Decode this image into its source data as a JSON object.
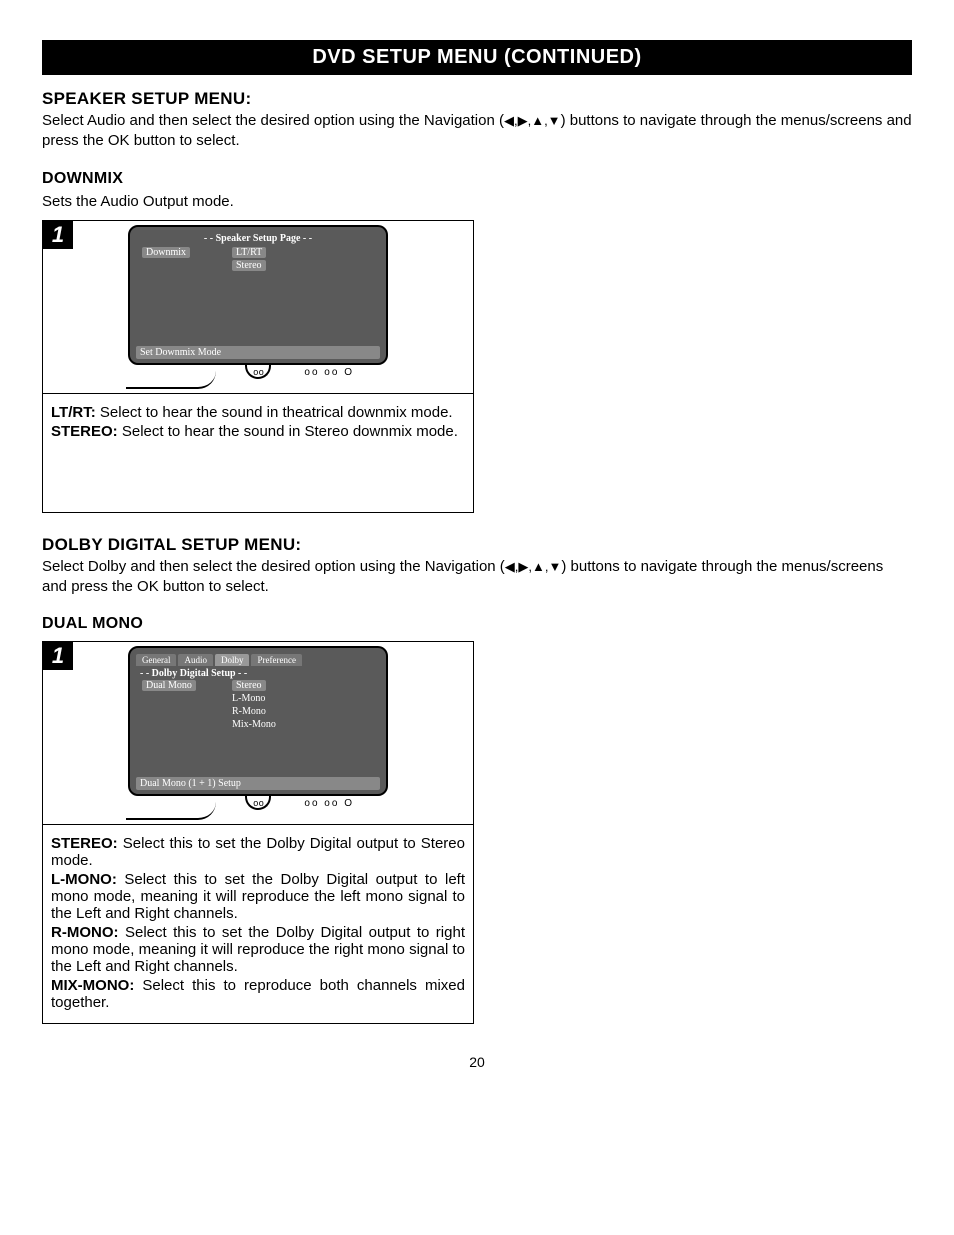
{
  "title_bar": "DVD SETUP MENU (CONTINUED)",
  "speaker": {
    "heading": "SPEAKER SETUP MENU:",
    "intro_a": "Select Audio and then select the desired option using the Navigation (",
    "intro_b": ") buttons to navigate through the menus/screens and press the OK button to select.",
    "arrows": "◀,▶,▲,▼"
  },
  "downmix": {
    "heading": "DOWNMIX",
    "intro": "Sets the Audio Output mode.",
    "step": "1",
    "screen": {
      "title": "- - Speaker Setup Page - -",
      "left": "Downmix",
      "opt1": "LT/RT",
      "opt2": "Stereo",
      "footer": "Set Downmix Mode"
    },
    "desc": {
      "ltrt_t": "LT/RT:",
      "ltrt": " Select to hear the sound in theatrical downmix mode.",
      "stereo_t": "STEREO:",
      "stereo": " Select to hear the sound in Stereo downmix mode."
    }
  },
  "dolby": {
    "heading": "DOLBY DIGITAL SETUP MENU:",
    "intro_a": "Select Dolby and then select the desired option using the Navigation (",
    "intro_b": ") buttons to navigate through the menus/screens and press the OK button to select.",
    "arrows": "◀,▶,▲,▼"
  },
  "dualmono": {
    "heading": "DUAL MONO",
    "step": "1",
    "screen": {
      "tabs": {
        "t1": "General",
        "t2": "Audio",
        "t3": "Dolby",
        "t4": "Preference"
      },
      "title": "- - Dolby Digital Setup - -",
      "left": "Dual Mono",
      "opt1": "Stereo",
      "opt2": "L-Mono",
      "opt3": "R-Mono",
      "opt4": "Mix-Mono",
      "footer": "Dual Mono (1 + 1) Setup"
    },
    "desc": {
      "stereo_t": "STEREO:",
      "stereo": " Select this to set the Dolby Digital output to Stereo mode.",
      "lmono_t": "L-MONO:",
      "lmono": " Select this to set the Dolby Digital output to left mono mode, meaning it will reproduce the left mono signal to the Left and Right channels.",
      "rmono_t": "R-MONO:",
      "rmono": " Select this to set the Dolby Digital output to right mono mode, meaning it will reproduce the right mono signal to the Left and Right channels.",
      "mixmono_t": "MIX-MONO:",
      "mixmono": " Select this to reproduce both channels mixed together."
    }
  },
  "page_num": "20",
  "tv_neck_dots": "o o",
  "tv_indicators": "oo  oo  O"
}
